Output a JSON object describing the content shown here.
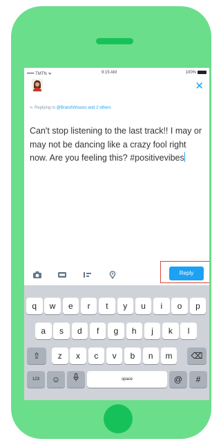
{
  "status_bar": {
    "carrier": "••••• TMTN ᯤ",
    "time": "9:15 AM",
    "battery": "100%"
  },
  "compose": {
    "replying_prefix": "Replying to",
    "replying_mentions": "@BrandVirtuoso and 2 others",
    "tweet_text": "Can't stop listening to the last track!! I may or may not be dancing like a crazy fool right now. Are you feeling this? #positivevibes",
    "reply_label": "Reply",
    "close_glyph": "✕"
  },
  "keyboard": {
    "row1": [
      "q",
      "w",
      "e",
      "r",
      "t",
      "y",
      "u",
      "i",
      "o",
      "p"
    ],
    "row2": [
      "a",
      "s",
      "d",
      "f",
      "g",
      "h",
      "j",
      "k",
      "l"
    ],
    "row3": [
      "z",
      "x",
      "c",
      "v",
      "b",
      "n",
      "m"
    ],
    "shift": "⇧",
    "backspace": "⌫",
    "numbers": "123",
    "emoji": "☺",
    "mic": "🎙",
    "space": "space",
    "at": "@",
    "hash": "#"
  },
  "colors": {
    "phone_body": "#6bde8b",
    "phone_accent": "#17c15a",
    "twitter_blue": "#1da1f2",
    "highlight": "#d9443b"
  }
}
